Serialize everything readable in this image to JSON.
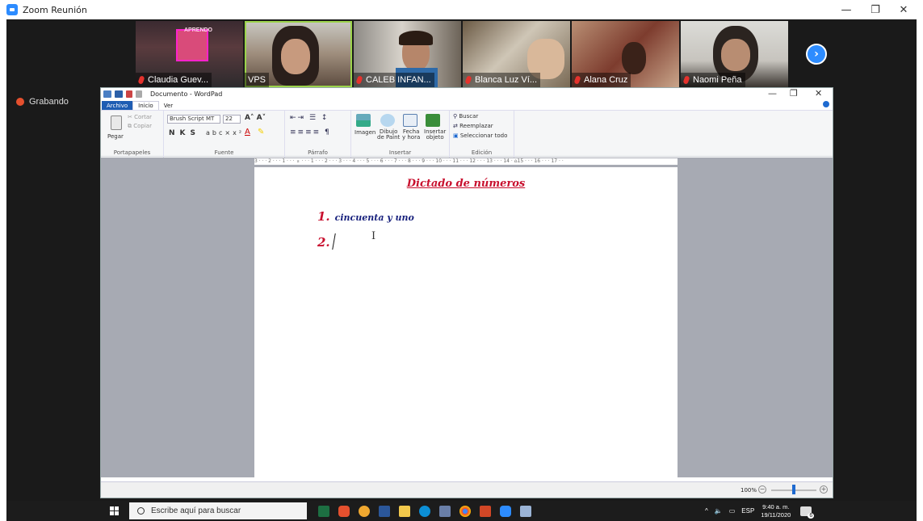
{
  "zoom": {
    "title": "Zoom Reunión",
    "recording_label": "Grabando",
    "participants": [
      {
        "name": "Claudia Guev...",
        "muted": true
      },
      {
        "name": "VPS",
        "muted": false,
        "active": true
      },
      {
        "name": "CALEB INFAN...",
        "muted": true
      },
      {
        "name": "Blanca Luz Ví...",
        "muted": true
      },
      {
        "name": "Alana Cruz",
        "muted": true
      },
      {
        "name": "Naomi  Peña",
        "muted": true
      }
    ],
    "colors": {
      "accent": "#2d8cff",
      "recording": "#e5502e"
    }
  },
  "wordpad": {
    "title": "Documento - WordPad",
    "tabs": [
      "Archivo",
      "Inicio",
      "Ver"
    ],
    "clipboard": {
      "paste": "Pegar",
      "cut": "Cortar",
      "copy": "Copiar",
      "group": "Portapapeles"
    },
    "font": {
      "family": "Brush Script MT",
      "size": "22",
      "group": "Fuente"
    },
    "paragraph": {
      "group": "Párrafo"
    },
    "insert": {
      "image": "Imagen",
      "paint_1": "Dibujo",
      "paint_2": "de Paint",
      "date_1": "Fecha",
      "date_2": "y hora",
      "object_1": "Insertar",
      "object_2": "objeto",
      "group": "Insertar"
    },
    "edit": {
      "find": "Buscar",
      "replace": "Reemplazar",
      "select_all": "Seleccionar todo",
      "group": "Edición"
    },
    "ruler": "3 · · · 2 · · · 1 · · · ⌅ · · · 1 · · · 2 · · · 3 · · · 4 · · · 5 · · · 6 · · · 7 · · · 8 · · · 9 · · · 10 · · · 11 · · · 12 · · · 13 · · · 14 · ⌂15 · · · 16 · · · 17 · ·",
    "document": {
      "title": "Dictado de números",
      "items": [
        {
          "num": "1.",
          "text": "cincuenta y uno"
        },
        {
          "num": "2.",
          "text": ""
        }
      ]
    },
    "status": {
      "zoom": "100%"
    }
  },
  "taskbar": {
    "search_placeholder": "Escribe aquí para buscar",
    "tray": {
      "lang": "ESP",
      "time": "9:40 a. m.",
      "date": "19/11/2020",
      "notifications": "6"
    }
  }
}
